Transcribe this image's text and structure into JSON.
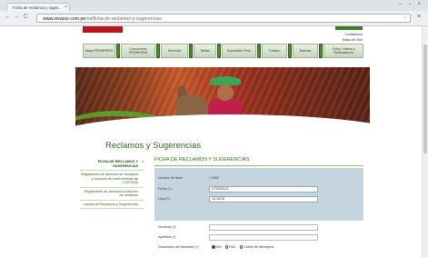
{
  "browser": {
    "tab_title": "Ficha de reclamos y suger...",
    "tab_close": "×",
    "window_controls": "– ▫ ×",
    "back": "←",
    "forward": "→",
    "reload": "C",
    "url_host": "www.invasur.com.pe",
    "url_path": "/es/ficha-de-reclamos-y-sugerencias",
    "star": "☆",
    "menu": "≡"
  },
  "header": {
    "logo_text": "",
    "top_link_1": "Contáctenos",
    "top_link_2": "Mapa del Sitio"
  },
  "menu": [
    {
      "label": "Mapa PROMPERÚ"
    },
    {
      "label": "Conocemos PROMPERÚ"
    },
    {
      "label": "Servicios"
    },
    {
      "label": "Tarifas"
    },
    {
      "label": "Exportador Perú"
    },
    {
      "label": "Turismo"
    },
    {
      "label": "Noticias"
    },
    {
      "label": "Fotos, Videos y Publicaciones"
    }
  ],
  "page": {
    "title": "Reclamos y Sugerencias",
    "form_title": "FICHA DE RECLAMOS Y SUGERENCIAS"
  },
  "sidenav": [
    {
      "label": "FICHA DE RECLAMOS Y SUGERENCIAS",
      "arrow": "»"
    },
    {
      "label": "Reglamento de atención de reclamos y solución de controversias de CUSTIMA",
      "arrow": ""
    },
    {
      "label": "Reglamento de atención a solución de reclamos",
      "arrow": ""
    },
    {
      "label": "Listado de Reclamos y Sugerencias",
      "arrow": ""
    }
  ],
  "form": {
    "numero_label": "Número de ficha:",
    "numero_value": "1 0360",
    "fecha_label": "Fecha (*):",
    "fecha_value": "27/02/2013",
    "hora_label": "Hora (*):",
    "hora_value": "14:16:20",
    "nombres_label": "Nombres (*):",
    "apellidos_label": "Apellidos (*):",
    "documento_label": "Documento de Identidad (*):",
    "doc_opt_1": "DNI",
    "doc_opt_2": "RUC",
    "doc_opt_3": "Carnet de extranjería"
  }
}
